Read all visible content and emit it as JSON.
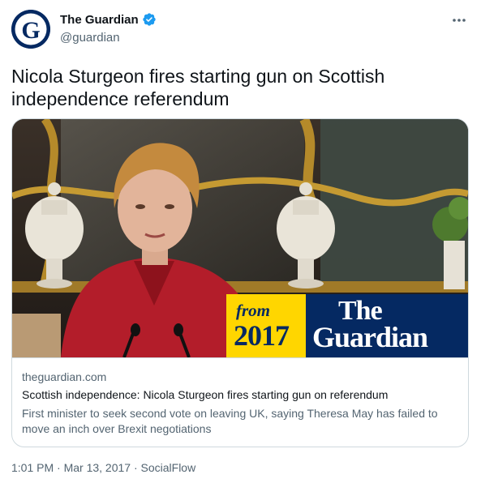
{
  "account": {
    "display_name": "The Guardian",
    "handle": "@guardian",
    "avatar_letter": "G",
    "verified_icon": "verified-badge-icon",
    "more_icon": "more-options-icon"
  },
  "tweet": {
    "text": "Nicola Sturgeon fires starting gun on Scottish independence referendum"
  },
  "card": {
    "domain": "theguardian.com",
    "title": "Scottish independence: Nicola Sturgeon fires starting gun on referendum",
    "description": "First minister to seek second vote on leaving UK, saying Theresa May has failed to move an inch over Brexit negotiations",
    "banner": {
      "from_label": "from",
      "year": "2017",
      "logo_line1": "The",
      "logo_line2": "Guardian"
    }
  },
  "meta": {
    "text": "1:01 PM · Mar 13, 2017 · SocialFlow"
  },
  "colors": {
    "brand_navy": "#052962",
    "banner_yellow": "#ffd600",
    "verified_blue": "#1d9bf0",
    "text_primary": "#0f1419",
    "text_secondary": "#536471",
    "border": "#cfd9de"
  }
}
